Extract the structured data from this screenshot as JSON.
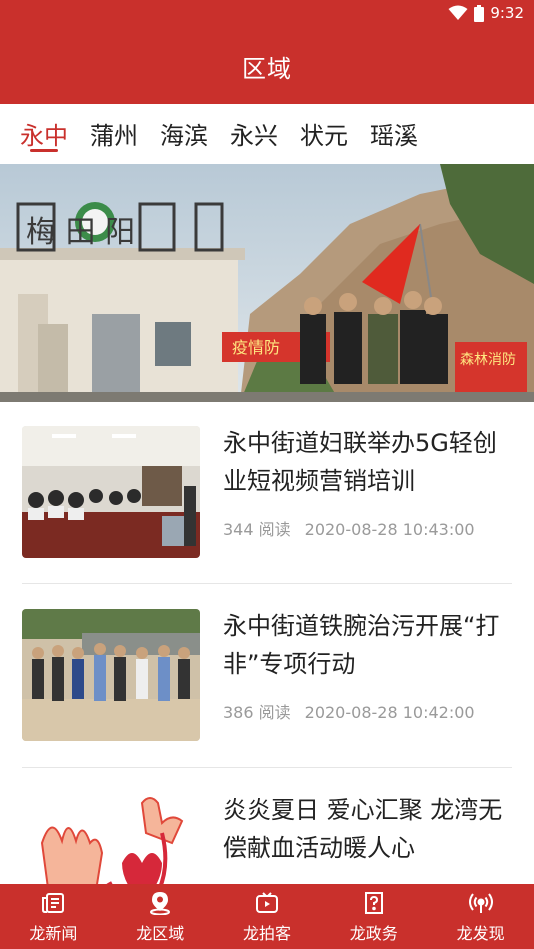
{
  "status_bar": {
    "time": "9:32"
  },
  "app_bar": {
    "title": "区域"
  },
  "tabs": [
    {
      "label": "永中",
      "active": true
    },
    {
      "label": "蒲州",
      "active": false
    },
    {
      "label": "海滨",
      "active": false
    },
    {
      "label": "永兴",
      "active": false
    },
    {
      "label": "状元",
      "active": false
    },
    {
      "label": "瑶溪",
      "active": false
    }
  ],
  "hero": {
    "sign_text": "梅 田 阳",
    "banner_left": "疫情防",
    "banner_right": "森林消防"
  },
  "news": [
    {
      "title": "永中街道妇联举办5G轻创业短视频营销培训",
      "reads": "344 阅读",
      "time": "2020-08-28 10:43:00"
    },
    {
      "title": "永中街道铁腕治污开展“打非”专项行动",
      "reads": "386 阅读",
      "time": "2020-08-28 10:42:00"
    },
    {
      "title": "炎炎夏日 爱心汇聚 龙湾无偿献血活动暖人心",
      "reads": "",
      "time": ""
    }
  ],
  "bottom_nav": [
    {
      "label": "龙新闻",
      "icon": "news-icon"
    },
    {
      "label": "龙区域",
      "icon": "location-icon",
      "active": true
    },
    {
      "label": "龙拍客",
      "icon": "video-icon"
    },
    {
      "label": "龙政务",
      "icon": "question-icon"
    },
    {
      "label": "龙发现",
      "icon": "broadcast-icon"
    }
  ],
  "colors": {
    "brand_red": "#c9302c",
    "meta_gray": "#9a9a9a"
  }
}
